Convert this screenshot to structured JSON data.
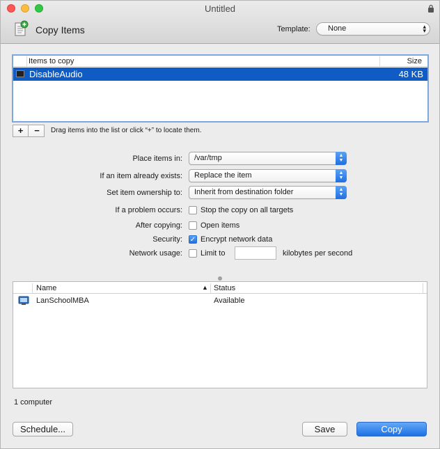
{
  "window": {
    "title": "Untitled"
  },
  "toolbar": {
    "app_title": "Copy Items",
    "template_label": "Template:",
    "template_value": "None"
  },
  "items_table": {
    "columns": [
      "Items to copy",
      "Size"
    ],
    "rows": [
      {
        "name": "DisableAudio",
        "size": "48 KB",
        "selected": true
      }
    ],
    "add_label": "+",
    "remove_label": "−",
    "hint": "Drag items into the list or click “+” to locate them."
  },
  "options": {
    "place_label": "Place items in:",
    "place_value": "/var/tmp",
    "exists_label": "If an item already exists:",
    "exists_value": "Replace the item",
    "ownership_label": "Set item ownership to:",
    "ownership_value": "Inherit from destination folder",
    "problem_label": "If a problem occurs:",
    "problem_text": "Stop the copy on all targets",
    "problem_checked": false,
    "after_label": "After copying:",
    "after_text": "Open items",
    "after_checked": false,
    "security_label": "Security:",
    "security_text": "Encrypt network data",
    "security_checked": true,
    "network_label": "Network usage:",
    "network_text": "Limit to",
    "network_checked": false,
    "network_value": "",
    "network_unit": "kilobytes per second"
  },
  "computers_table": {
    "columns": [
      "Name",
      "Status"
    ],
    "rows": [
      {
        "name": "LanSchoolMBA",
        "status": "Available"
      }
    ],
    "count": "1 computer"
  },
  "buttons": {
    "schedule": "Schedule...",
    "save": "Save",
    "copy": "Copy"
  },
  "colors": {
    "selection": "#0f5cc4",
    "accent": "#1d70e6"
  }
}
